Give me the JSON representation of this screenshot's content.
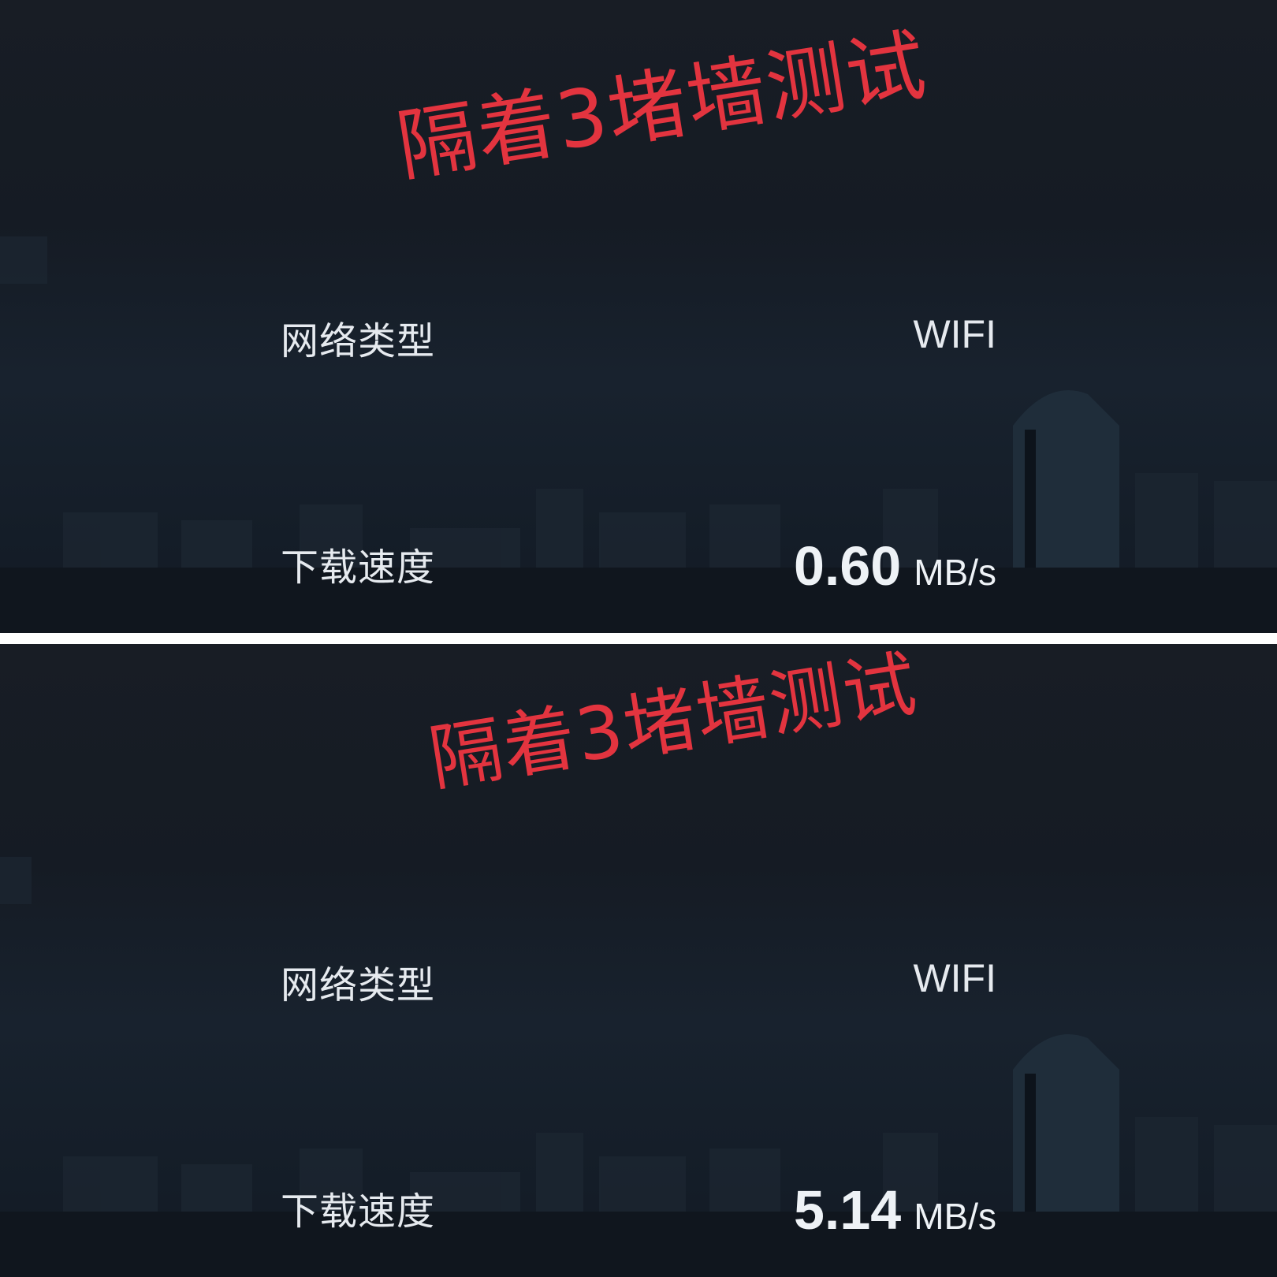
{
  "panels": [
    {
      "overlay_title": "隔着3堵墙测试",
      "network_type_label": "网络类型",
      "network_type_value": "WIFI",
      "download_speed_label": "下载速度",
      "download_speed_value": "0.60",
      "download_speed_unit": "MB/s"
    },
    {
      "overlay_title": "隔着3堵墙测试",
      "network_type_label": "网络类型",
      "network_type_value": "WIFI",
      "download_speed_label": "下载速度",
      "download_speed_value": "5.14",
      "download_speed_unit": "MB/s"
    }
  ],
  "colors": {
    "overlay_red": "#e3343f",
    "background_dark": "#161c25",
    "text_light": "#e6eaef"
  }
}
